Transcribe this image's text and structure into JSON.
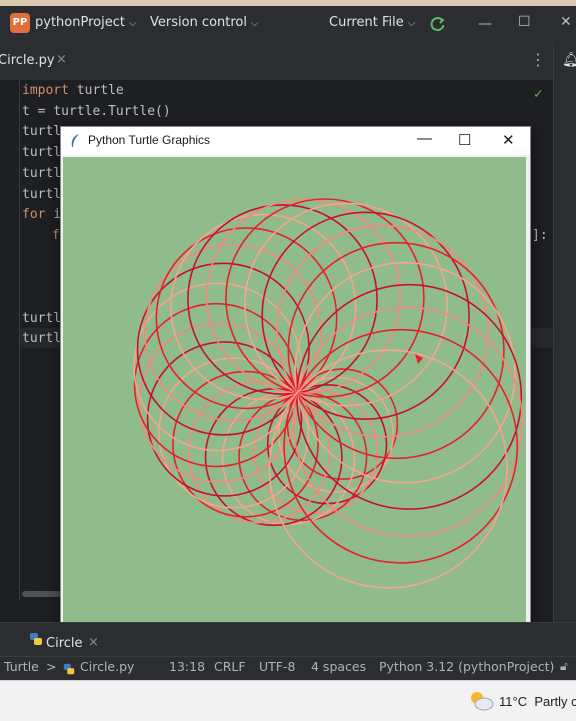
{
  "project": {
    "badge": "PP",
    "name": "pythonProject"
  },
  "titlebar": {
    "version_control": "Version control",
    "current_file": "Current File"
  },
  "tab": {
    "name": "Circle.py",
    "close": "×"
  },
  "editor": {
    "lines": [
      {
        "kw": "import",
        "rest": " turtle"
      },
      {
        "kw": "",
        "rest": "t = turtle.Turtle()"
      },
      {
        "kw": "",
        "rest": "turtl"
      },
      {
        "kw": "",
        "rest": "turtl"
      },
      {
        "kw": "",
        "rest": "turtl"
      },
      {
        "kw": "",
        "rest": "turtl"
      },
      {
        "kw": "for",
        "rest": " i"
      },
      {
        "kw": "f",
        "rest": ""
      },
      {
        "kw": "",
        "rest": ""
      },
      {
        "kw": "",
        "rest": ""
      },
      {
        "kw": "",
        "rest": ""
      },
      {
        "kw": "",
        "rest": "turtl"
      },
      {
        "kw": "",
        "rest": "turtl"
      }
    ],
    "bracket_fragment": "]:"
  },
  "turtle_window": {
    "title": "Python Turtle Graphics",
    "canvas_bg": "#8fbc8a",
    "pen_colors": [
      "#e8202a",
      "#f4a58a",
      "#c8102e",
      "#f08a7a"
    ]
  },
  "run_panel": {
    "label": "Circle",
    "close": "×"
  },
  "statusbar": {
    "breadcrumb_root": "Turtle",
    "breadcrumb_sep": ">",
    "file": "Circle.py",
    "position": "13:18",
    "line_sep": "CRLF",
    "encoding": "UTF-8",
    "indent": "4 spaces",
    "interpreter": "Python 3.12 (pythonProject)"
  },
  "taskbar": {
    "weather_temp": "11°C",
    "weather_desc": "Partly c"
  },
  "colors": {
    "accent": "#3574f0",
    "ide_bg": "#1e1f22",
    "panel_bg": "#2b2d30",
    "keyword": "#cf8e6d"
  }
}
